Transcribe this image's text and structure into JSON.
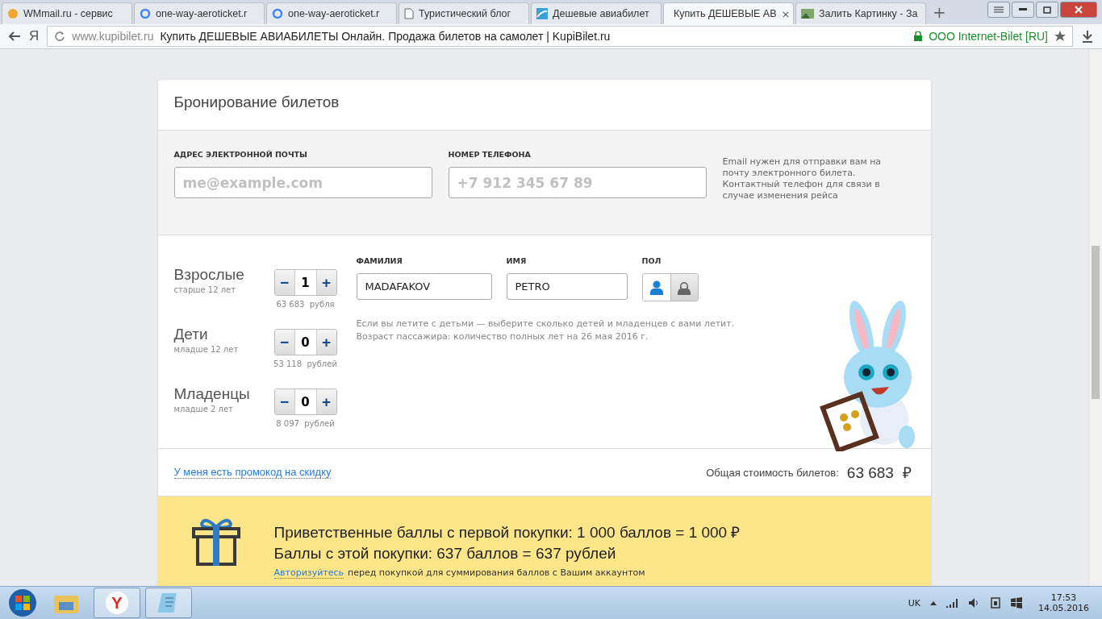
{
  "browser": {
    "tabs": [
      {
        "title": "WMmail.ru - сервис",
        "selected": false
      },
      {
        "title": "one-way-aeroticket.r",
        "selected": false
      },
      {
        "title": "one-way-aeroticket.r",
        "selected": false
      },
      {
        "title": "Туристический блог",
        "selected": false
      },
      {
        "title": "Дешевые авиабилет",
        "selected": false
      },
      {
        "title": "Купить ДЕШЕВЫЕ АВ",
        "selected": true
      },
      {
        "title": "Залить Картинку - За",
        "selected": false
      }
    ],
    "close_glyph": "×",
    "new_tab_glyph": "+",
    "yandex_glyph": "Я",
    "address": {
      "domain": "www.kupibilet.ru",
      "title": "Купить ДЕШЕВЫЕ АВИАБИЛЕТЫ Онлайн. Продажа билетов на самолет | KupiBilet.ru",
      "certificate": "ООО Internet-Bilet [RU]"
    }
  },
  "booking": {
    "title": "Бронирование билетов",
    "contact": {
      "email_label": "АДРЕС ЭЛЕКТРОННОЙ ПОЧТЫ",
      "email_placeholder": "me@example.com",
      "phone_label": "НОМЕР ТЕЛЕФОНА",
      "phone_placeholder": "+7 912 345 67 89",
      "note": "Email нужен для отправки вам на почту электронного билета. Контактный телефон для связи в случае изменения рейса"
    },
    "passengers": {
      "minus_glyph": "−",
      "plus_glyph": "+",
      "rows": [
        {
          "label": "Взрослые",
          "age": "старше 12 лет",
          "count": "1",
          "price": "63 683",
          "unit": "рубля"
        },
        {
          "label": "Дети",
          "age": "младше 12 лет",
          "count": "0",
          "price": "53 118",
          "unit": "рублей"
        },
        {
          "label": "Младенцы",
          "age": "младше 2 лет",
          "count": "0",
          "price": "8 097",
          "unit": "рублей"
        }
      ],
      "surname_label": "ФАМИЛИЯ",
      "surname": "MADAFAKOV",
      "name_label": "ИМЯ",
      "name": "PETRO",
      "gender_label": "ПОЛ",
      "genders": [
        {
          "kind": "male",
          "selected": true
        },
        {
          "kind": "female",
          "selected": false
        }
      ],
      "hint": [
        "Если вы летите с детьми — выберите сколько детей и младенцев с вами летит.",
        "Возраст пассажира: количество полных лет на 26 мая 2016 г."
      ]
    },
    "promo_link": "У меня есть промокод на скидку",
    "total_label": "Общая стоимость билетов:",
    "total": "63 683",
    "currency": "₽",
    "bonus": {
      "line_1": "Приветственные баллы с первой покупки: 1 000  баллов = 1 000 ₽",
      "line_2": "Баллы с этой покупки: 637  баллов = 637  рублей",
      "login_link": "Авторизуйтесь",
      "login_note": "перед покупкой для суммирования баллов с Вашим аккаунтом"
    }
  },
  "taskbar": {
    "yandex_glyph": "Y",
    "language": "UK",
    "time": "17:53",
    "date": "14.05.2016"
  }
}
